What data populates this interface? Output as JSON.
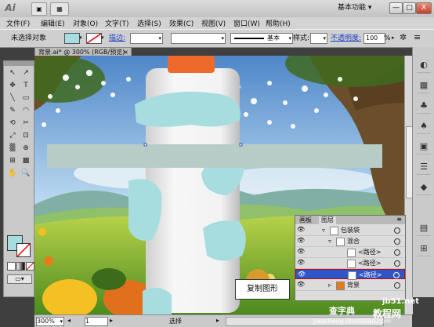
{
  "app": {
    "logo": "Ai",
    "view_btn": "▣",
    "arrange_btn": "▦"
  },
  "menus": [
    "文件(F)",
    "编辑(E)",
    "对象(O)",
    "文字(T)",
    "选择(S)",
    "效果(C)",
    "视图(V)",
    "窗口(W)",
    "帮助(H)"
  ],
  "workspace": "基本功能",
  "window_buttons": [
    "—",
    "□",
    "X"
  ],
  "control_bar": {
    "selection_label": "未选择对象",
    "stroke_label": "描边:",
    "brush_value": "基本",
    "style_label": "样式:",
    "opacity_label": "不透明度:",
    "opacity_value": "100",
    "opacity_unit": "%"
  },
  "doc_tab": "背景.ai* @ 300% (RGB/预览)",
  "tools": [
    "↖",
    "↗",
    "✥",
    "T",
    "╲",
    "▭",
    "✎",
    "◠",
    "⟲",
    "✂",
    "⤢",
    "⊡",
    "▒",
    "⊕",
    "⊞",
    "▩",
    "✋",
    "🔍"
  ],
  "dock_icons": [
    "◐",
    "▦",
    "♣",
    "♠",
    "▣",
    "☰",
    "◆",
    "▤",
    "⊞"
  ],
  "status": {
    "zoom": "300%",
    "page": "1",
    "mode": "选择"
  },
  "layers_panel": {
    "tabs": [
      "画板",
      "图层"
    ],
    "rows": [
      {
        "label": "包装袋",
        "indent": 0,
        "selected": false
      },
      {
        "label": "混合",
        "indent": 1,
        "selected": false
      },
      {
        "label": "<路径>",
        "indent": 2,
        "selected": false
      },
      {
        "label": "<路径>",
        "indent": 2,
        "selected": false
      },
      {
        "label": "<路径>",
        "indent": 2,
        "selected": true
      },
      {
        "label": "背景",
        "indent": 1,
        "selected": false
      }
    ]
  },
  "tooltip": "复制图形",
  "watermarks": [
    "jb51.net",
    "教程网",
    "jiaocheng.chazidian.com",
    "查字典"
  ],
  "colors": {
    "fill": "#a8dde0",
    "selection": "#2f56c9",
    "shape": "#a8dde0",
    "gray_bar": "#b8ccc7"
  }
}
